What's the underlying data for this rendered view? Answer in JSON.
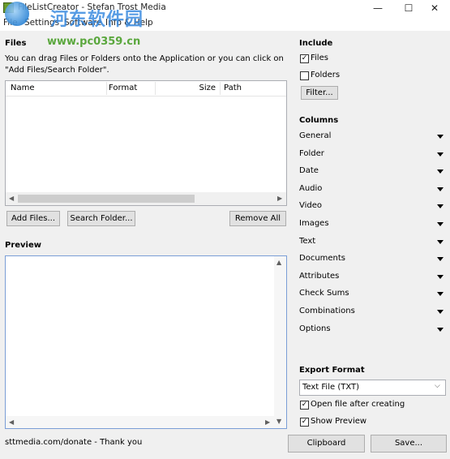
{
  "window": {
    "title": "FileListCreator - Stefan Trost Media",
    "minimize": "—",
    "maximize": "☐",
    "close": "✕"
  },
  "menu": {
    "items": [
      "File",
      "Settings",
      "Software",
      "Info & Help"
    ]
  },
  "watermark": {
    "line1": "河东软件园",
    "line2": "www.pc0359.cn"
  },
  "files": {
    "title": "Files",
    "instructions_line1": "You can drag Files or Folders onto the Application or you can click on",
    "instructions_line2": "\"Add Files/Search Folder\".",
    "columns": [
      "Name",
      "Format",
      "Size",
      "Path"
    ],
    "add_files": "Add Files...",
    "search_folder": "Search Folder...",
    "remove_all": "Remove All"
  },
  "preview": {
    "title": "Preview"
  },
  "include": {
    "title": "Include",
    "files_label": "Files",
    "files_checked": true,
    "folders_label": "Folders",
    "folders_checked": false,
    "filter": "Filter..."
  },
  "columns": {
    "title": "Columns",
    "items": [
      "General",
      "Folder",
      "Date",
      "Audio",
      "Video",
      "Images",
      "Text",
      "Documents",
      "Attributes",
      "Check Sums",
      "Combinations",
      "Options"
    ]
  },
  "export": {
    "title": "Export Format",
    "format_value": "Text File (TXT)",
    "open_after_label": "Open file after creating",
    "open_after_checked": true,
    "show_preview_label": "Show Preview",
    "show_preview_checked": true
  },
  "footer": {
    "donate": "sttmedia.com/donate - Thank you",
    "clipboard": "Clipboard",
    "save": "Save..."
  }
}
